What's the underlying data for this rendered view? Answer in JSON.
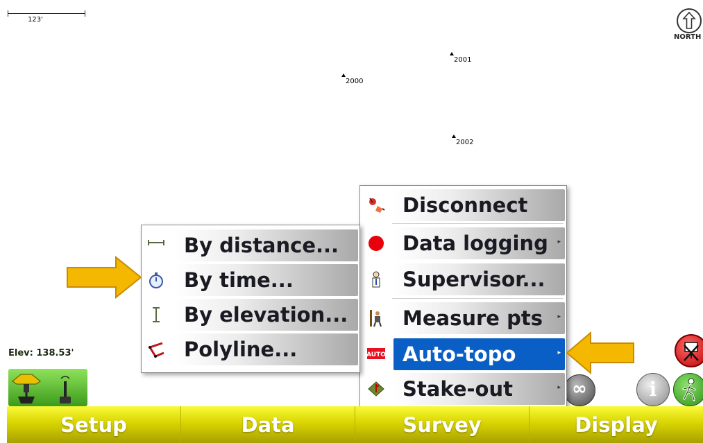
{
  "map": {
    "scale_label": "123'",
    "north_label": "NORTH",
    "points": [
      {
        "label": "2001"
      },
      {
        "label": "2000"
      },
      {
        "label": "2002"
      }
    ]
  },
  "status": {
    "elevation": "Elev: 138.53'"
  },
  "survey_menu": {
    "items": [
      {
        "label": "Disconnect",
        "icon": "disconnect-icon",
        "submenu": false
      },
      {
        "label": "Data logging",
        "icon": "data-logging-icon",
        "submenu": true
      },
      {
        "label": "Supervisor...",
        "icon": "supervisor-icon",
        "submenu": false
      },
      {
        "label": "Measure pts",
        "icon": "measure-pts-icon",
        "submenu": true
      },
      {
        "label": "Auto-topo",
        "icon": "auto-topo-icon",
        "icon_text": "AUTO",
        "submenu": true,
        "selected": true
      },
      {
        "label": "Stake-out",
        "icon": "stake-out-icon",
        "submenu": true
      }
    ],
    "submenu_marker": "▸"
  },
  "autotopo_menu": {
    "items": [
      {
        "label": "By distance...",
        "icon": "distance-icon"
      },
      {
        "label": "By time...",
        "icon": "stopwatch-icon"
      },
      {
        "label": "By elevation...",
        "icon": "elevation-icon"
      },
      {
        "label": "Polyline...",
        "icon": "polyline-icon"
      }
    ]
  },
  "bottom_bar": {
    "tabs": [
      "Setup",
      "Data",
      "Survey",
      "Display"
    ]
  },
  "buttons": {
    "info": "i",
    "infinity": "∞"
  },
  "colors": {
    "selection": "#0a5fc6",
    "bar_yellow": "#d9d500",
    "arrow_orange": "#f5b800"
  }
}
